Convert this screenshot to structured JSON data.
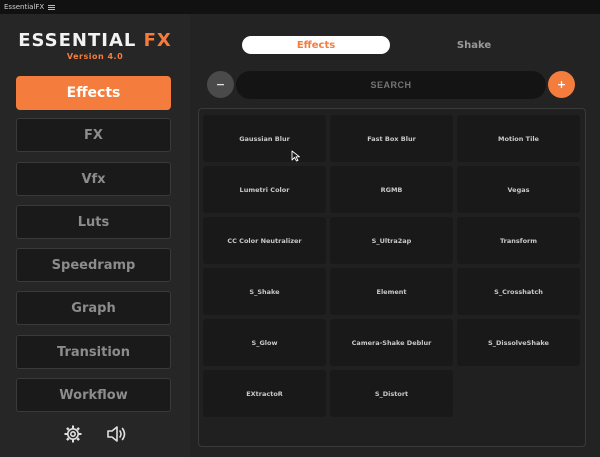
{
  "window": {
    "title": "EssentialFX"
  },
  "app": {
    "name_main": "ESSENTIAL",
    "name_accent": "FX",
    "version": "Version 4.0",
    "accent_color": "#f47c3c"
  },
  "sidebar": {
    "items": [
      {
        "label": "Effects",
        "active": true
      },
      {
        "label": "FX",
        "active": false
      },
      {
        "label": "Vfx",
        "active": false
      },
      {
        "label": "Luts",
        "active": false
      },
      {
        "label": "Speedramp",
        "active": false
      },
      {
        "label": "Graph",
        "active": false
      },
      {
        "label": "Transition",
        "active": false
      },
      {
        "label": "Workflow",
        "active": false
      }
    ],
    "bottom_icons": [
      "gear-icon",
      "speaker-icon"
    ]
  },
  "tabs": [
    {
      "label": "Effects",
      "active": true
    },
    {
      "label": "Shake",
      "active": false
    }
  ],
  "search": {
    "minus_label": "−",
    "placeholder": "SEARCH",
    "plus_label": "+"
  },
  "effects": [
    "Gaussian Blur",
    "Fast Box Blur",
    "Motion Tile",
    "Lumetri Color",
    "RGMB",
    "Vegas",
    "CC Color Neutralizer",
    "S_Ultra2ap",
    "Transform",
    "S_Shake",
    "Element",
    "S_Crosshatch",
    "S_Glow",
    "Camera-Shake Deblur",
    "S_DissolveShake",
    "EXtractoR",
    "S_Distort"
  ]
}
